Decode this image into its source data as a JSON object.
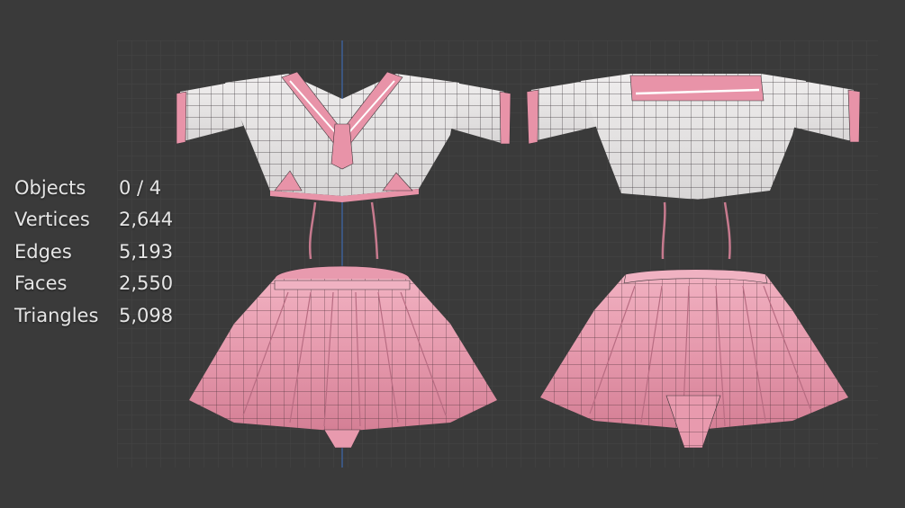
{
  "stats": {
    "rows": [
      {
        "label": "Objects",
        "value": "0 / 4"
      },
      {
        "label": "Vertices",
        "value": "2,644"
      },
      {
        "label": "Edges",
        "value": "5,193"
      },
      {
        "label": "Faces",
        "value": "2,550"
      },
      {
        "label": "Triangles",
        "value": "5,098"
      }
    ]
  },
  "colors": {
    "background": "#3a3a3a",
    "grid": "#444444",
    "shirt": "#e5e3e3",
    "skirt": "#e89aae",
    "trim": "#e893a8",
    "wire": "#3a3438",
    "axis": "#3a5f9a"
  },
  "objects": [
    {
      "name": "shirt-front",
      "icon": "mesh-icon"
    },
    {
      "name": "shirt-back",
      "icon": "mesh-icon"
    },
    {
      "name": "skirt-front",
      "icon": "mesh-icon"
    },
    {
      "name": "skirt-back",
      "icon": "mesh-icon"
    }
  ]
}
